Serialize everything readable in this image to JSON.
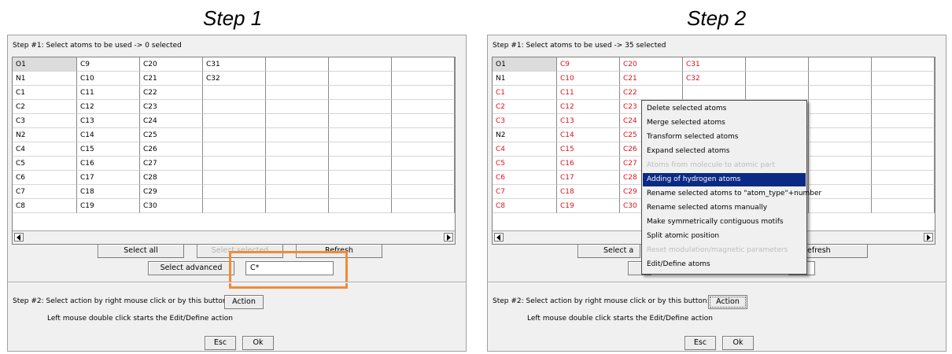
{
  "captions": {
    "left": "Step 1",
    "right": "Step 2"
  },
  "dialog": {
    "columns": [
      [
        "O1",
        "N1",
        "C1",
        "C2",
        "C3",
        "N2",
        "C4",
        "C5",
        "C6",
        "C7",
        "C8"
      ],
      [
        "C9",
        "C10",
        "C11",
        "C12",
        "C13",
        "C14",
        "C15",
        "C16",
        "C17",
        "C18",
        "C19"
      ],
      [
        "C20",
        "C21",
        "C22",
        "C23",
        "C24",
        "C25",
        "C26",
        "C27",
        "C28",
        "C29",
        "C30"
      ],
      [
        "C31",
        "C32"
      ],
      [],
      [],
      []
    ],
    "select_all_label": "Select all",
    "select_selected_label": "Select selected",
    "refresh_label": "Refresh",
    "select_advanced_label": "Select advanced",
    "advanced_filter_value": "C*",
    "step2_text": "Step #2: Select action by right mouse click or by this button:",
    "action_label": "Action",
    "hint_text": "Left mouse double click starts the Edit/Define action",
    "esc_label": "Esc",
    "ok_label": "Ok"
  },
  "step1": {
    "title": "Step #1: Select atoms to be used  -> 0 selected",
    "selected_atoms": []
  },
  "step2": {
    "title": "Step #1: Select atoms to be used  -> 35 selected",
    "selected_atoms": [
      "C1",
      "C2",
      "C3",
      "C4",
      "C5",
      "C6",
      "C7",
      "C8",
      "C9",
      "C10",
      "C11",
      "C12",
      "C13",
      "C14",
      "C15",
      "C16",
      "C17",
      "C18",
      "C19",
      "C20",
      "C21",
      "C22",
      "C23",
      "C24",
      "C25",
      "C26",
      "C27",
      "C28",
      "C29",
      "C30",
      "C31",
      "C32"
    ],
    "partial_select_label": "Select a",
    "partial_refresh_label": "efresh",
    "context_menu": [
      {
        "label": "Delete selected atoms",
        "enabled": true
      },
      {
        "label": "Merge selected atoms",
        "enabled": true
      },
      {
        "label": "Transform selected atoms",
        "enabled": true
      },
      {
        "label": "Expand selected atoms",
        "enabled": true
      },
      {
        "label": "Atoms from molecule to atomic part",
        "enabled": false
      },
      {
        "label": "Adding of hydrogen atoms",
        "enabled": true,
        "active": true
      },
      {
        "label": "Rename selected atoms to \"atom_type\"+number",
        "enabled": true
      },
      {
        "label": "Rename selected atoms manually",
        "enabled": true
      },
      {
        "label": "Make symmetrically contiguous motifs",
        "enabled": true
      },
      {
        "label": "Split atomic position",
        "enabled": true
      },
      {
        "label": "Reset modulation/magnetic parameters",
        "enabled": false
      },
      {
        "label": "Edit/Define atoms",
        "enabled": true
      }
    ]
  },
  "colors": {
    "selected_text": "#e0121a",
    "menu_highlight": "#0a2a84",
    "annotation": "#ef8b3a"
  }
}
